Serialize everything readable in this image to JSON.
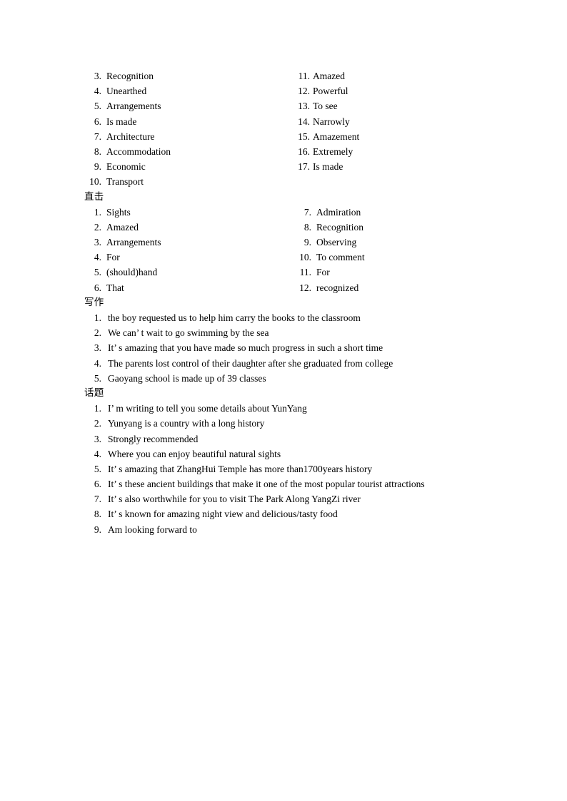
{
  "document": {
    "title": "English Answer Key",
    "text_color": "#000000",
    "background_color": "#ffffff"
  },
  "sections": [
    {
      "id": "block-vocabulary",
      "heading": null,
      "layout": "two-column",
      "left_items": [
        {
          "num": "3.",
          "text": "Recognition"
        },
        {
          "num": "4.",
          "text": "Unearthed"
        },
        {
          "num": "5.",
          "text": "Arrangements"
        },
        {
          "num": "6.",
          "text": "Is made"
        },
        {
          "num": "7.",
          "text": "Architecture"
        },
        {
          "num": "8.",
          "text": "Accommodation"
        },
        {
          "num": "9.",
          "text": "Economic"
        },
        {
          "num": "10.",
          "text": "Transport"
        }
      ],
      "right_items": [
        {
          "num": "11.",
          "text": "Amazed"
        },
        {
          "num": "12.",
          "text": "Powerful"
        },
        {
          "num": "13.",
          "text": "To see"
        },
        {
          "num": "14.",
          "text": "Narrowly"
        },
        {
          "num": "15.",
          "text": "Amazement"
        },
        {
          "num": "16.",
          "text": "Extremely"
        },
        {
          "num": "17.",
          "text": "Is made"
        }
      ]
    },
    {
      "id": "block-zhiji",
      "heading": "直击",
      "layout": "two-column",
      "left_items": [
        {
          "num": "1.",
          "text": "Sights"
        },
        {
          "num": "2.",
          "text": "Amazed"
        },
        {
          "num": "3.",
          "text": "Arrangements"
        },
        {
          "num": "4.",
          "text": "For"
        },
        {
          "num": "5.",
          "text": "(should)hand"
        },
        {
          "num": "6.",
          "text": "That"
        }
      ],
      "right_items": [
        {
          "num": "7.",
          "text": "Admiration"
        },
        {
          "num": "8.",
          "text": "Recognition"
        },
        {
          "num": "9.",
          "text": "Observing"
        },
        {
          "num": "10.",
          "text": "To comment"
        },
        {
          "num": "11.",
          "text": "For"
        },
        {
          "num": "12.",
          "text": "recognized"
        }
      ]
    },
    {
      "id": "block-xiezuo",
      "heading": "写作",
      "layout": "single-column",
      "items": [
        {
          "num": "1.",
          "text": "the boy requested us to help him carry the books to the classroom"
        },
        {
          "num": "2.",
          "text": "We can’ t wait to go swimming by the sea"
        },
        {
          "num": "3.",
          "text": "It’ s amazing that you have made so much progress in such a short time"
        },
        {
          "num": "4.",
          "text": "The parents lost control of their daughter after she graduated from college"
        },
        {
          "num": "5.",
          "text": "Gaoyang school is made up of 39 classes"
        }
      ]
    },
    {
      "id": "block-huati",
      "heading": "话题",
      "layout": "single-column",
      "items": [
        {
          "num": "1.",
          "text": "I’ m writing to tell you some details about YunYang"
        },
        {
          "num": "2.",
          "text": "Yunyang is a country with a long history"
        },
        {
          "num": "3.",
          "text": "Strongly recommended"
        },
        {
          "num": "4.",
          "text": "Where you can enjoy beautiful natural sights"
        },
        {
          "num": "5.",
          "text": "It’ s amazing that ZhangHui Temple has more than1700years history"
        },
        {
          "num": "6.",
          "text": "It’ s these ancient buildings that make it one of the most popular tourist attractions"
        },
        {
          "num": "7.",
          "text": "It’ s also worthwhile for you to visit The Park Along YangZi river"
        },
        {
          "num": "8.",
          "text": "It’ s known for amazing night view and delicious/tasty food"
        },
        {
          "num": "9.",
          "text": "Am looking forward to"
        }
      ]
    }
  ]
}
